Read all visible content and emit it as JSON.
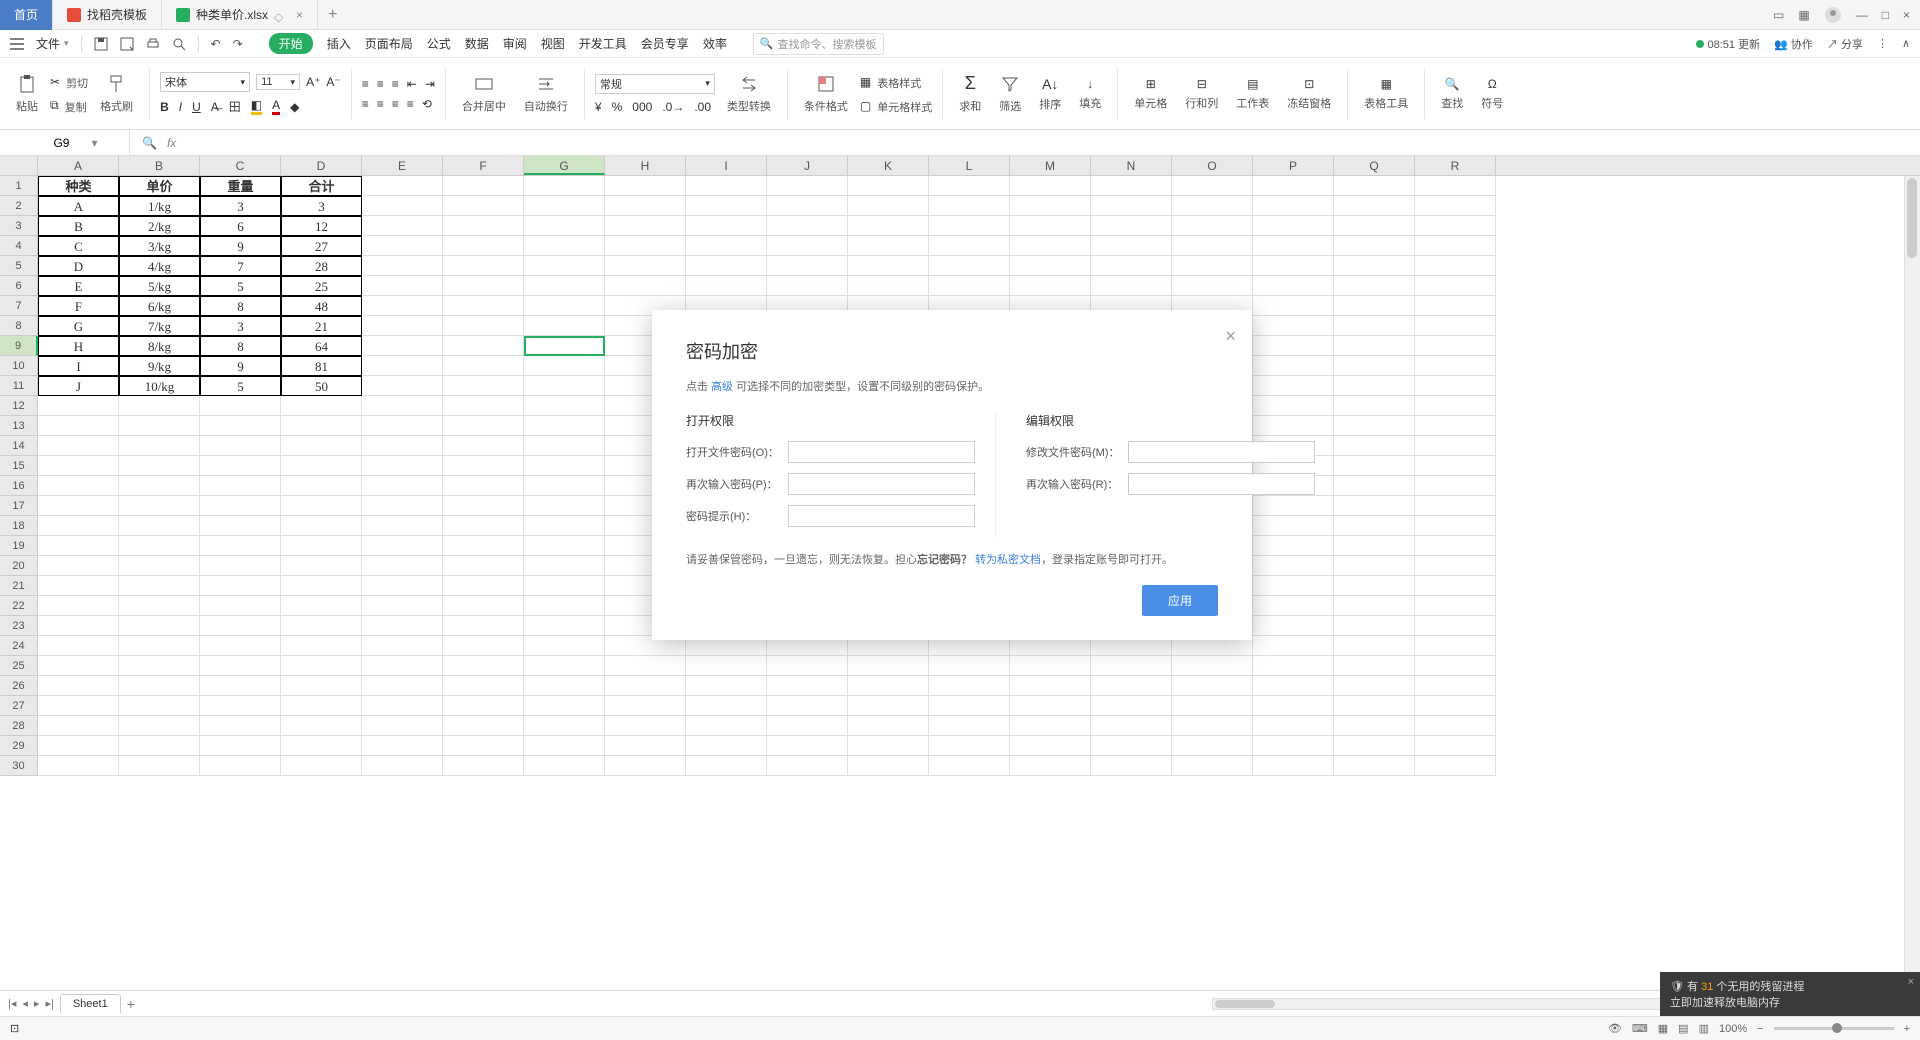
{
  "titlebar": {
    "home": "首页",
    "tab2": "找稻壳模板",
    "tab3": "种类单价.xlsx"
  },
  "menu": {
    "file": "文件",
    "tabs": [
      "开始",
      "插入",
      "页面布局",
      "公式",
      "数据",
      "审阅",
      "视图",
      "开发工具",
      "会员专享",
      "效率"
    ],
    "search_placeholder": "查找命令、搜索模板",
    "time": "08:51 更新",
    "coop": "协作",
    "share": "分享"
  },
  "ribbon": {
    "paste": "粘贴",
    "cut": "剪切",
    "copy": "复制",
    "fmt": "格式刷",
    "font": "宋体",
    "size": "11",
    "merge": "合并居中",
    "wrap": "自动换行",
    "general": "常规",
    "typeconv": "类型转换",
    "condfmt": "条件格式",
    "tablestyle": "表格样式",
    "cellstyle": "单元格样式",
    "sum": "求和",
    "filter": "筛选",
    "sort": "排序",
    "fill": "填充",
    "cell": "单元格",
    "rowcol": "行和列",
    "sheet": "工作表",
    "freeze": "冻结窗格",
    "tabletool": "表格工具",
    "find": "查找",
    "symbol": "符号"
  },
  "namebox": "G9",
  "columns": [
    "A",
    "B",
    "C",
    "D",
    "E",
    "F",
    "G",
    "H",
    "I",
    "J",
    "K",
    "L",
    "M",
    "N",
    "O",
    "P",
    "Q",
    "R"
  ],
  "table": {
    "headers": [
      "种类",
      "单价",
      "重量",
      "合计"
    ],
    "rows": [
      [
        "A",
        "1/kg",
        "3",
        "3"
      ],
      [
        "B",
        "2/kg",
        "6",
        "12"
      ],
      [
        "C",
        "3/kg",
        "9",
        "27"
      ],
      [
        "D",
        "4/kg",
        "7",
        "28"
      ],
      [
        "E",
        "5/kg",
        "5",
        "25"
      ],
      [
        "F",
        "6/kg",
        "8",
        "48"
      ],
      [
        "G",
        "7/kg",
        "3",
        "21"
      ],
      [
        "H",
        "8/kg",
        "8",
        "64"
      ],
      [
        "I",
        "9/kg",
        "9",
        "81"
      ],
      [
        "J",
        "10/kg",
        "5",
        "50"
      ]
    ]
  },
  "dialog": {
    "title": "密码加密",
    "desc_pre": "点击 ",
    "desc_link": "高级",
    "desc_post": " 可选择不同的加密类型，设置不同级别的密码保护。",
    "open_section": "打开权限",
    "edit_section": "编辑权限",
    "open_pwd": "打开文件密码(O)：",
    "open_again": "再次输入密码(P)：",
    "hint": "密码提示(H)：",
    "edit_pwd": "修改文件密码(M)：",
    "edit_again": "再次输入密码(R)：",
    "note_pre": "请妥善保管密码，一旦遗忘，则无法恢复。担心",
    "note_bold": "忘记密码？",
    "note_link": "转为私密文档",
    "note_post": "，登录指定账号即可打开。",
    "apply": "应用"
  },
  "sheet": {
    "name": "Sheet1"
  },
  "status": {
    "zoom": "100%"
  },
  "notif": {
    "pre": "有 ",
    "count": "31",
    "mid": " 个无用的残留进程",
    "line2": "立即加速释放电脑内存"
  }
}
